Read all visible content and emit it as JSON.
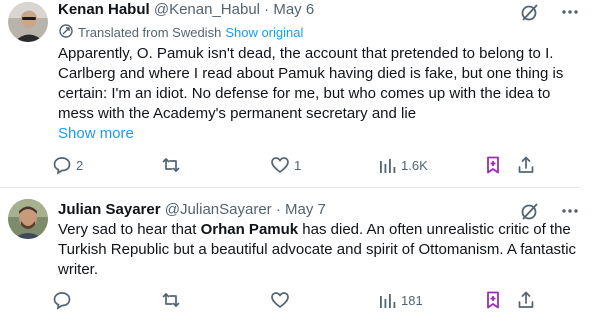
{
  "tweets": [
    {
      "author_name": "Kenan Habul",
      "handle": "@Kenan_Habul",
      "separator": "·",
      "date": "May 6",
      "translated_label": "Translated from Swedish",
      "show_original_label": "Show original",
      "body": "Apparently, O. Pamuk isn't dead, the account that pretended to belong to I. Carlberg and where I read about Pamuk having died is fake, but one thing is certain: I'm an idiot. No defense for me, but who comes up with the idea to mess with the Academy's permanent secretary and lie",
      "show_more_label": "Show more",
      "stats": {
        "replies": "2",
        "retweets": "",
        "likes": "1",
        "views": "1.6K"
      }
    },
    {
      "author_name": "Julian Sayarer",
      "handle": "@JulianSayarer",
      "separator": "·",
      "date": "May 7",
      "body_part1": "Very sad to hear that ",
      "body_bold": "Orhan Pamuk",
      "body_part2": " has died. An often unrealistic critic of the Turkish Republic but a beautiful advocate and spirit of Ottomanism. A fantastic writer.",
      "stats": {
        "replies": "",
        "retweets": "",
        "likes": "",
        "views": "181"
      }
    }
  ],
  "icons": {
    "grok": "grok-slash-icon",
    "more": "more-dots-icon",
    "reply": "reply-bubble-icon",
    "retweet": "retweet-arrows-icon",
    "like": "heart-icon",
    "views": "views-bar-chart-icon",
    "bookmark": "bookmark-icon",
    "share": "share-upload-icon",
    "translate": "translate-icon"
  },
  "colors": {
    "text_primary": "#0f1419",
    "text_secondary": "#536471",
    "link": "#1d9bf0",
    "bookmark_active": "#9b2db6",
    "divider": "#e6e9ec"
  }
}
